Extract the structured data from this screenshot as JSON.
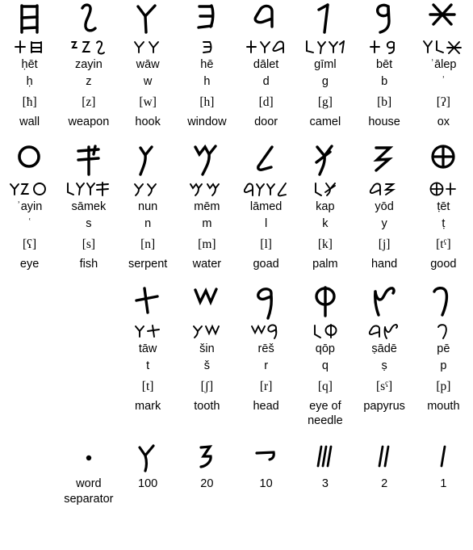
{
  "page": {
    "title": "Phoenician alphabet chart",
    "ink_color": "#000000",
    "background_color": "#ffffff"
  },
  "rows": [
    {
      "row_id": "row-1",
      "letters": [
        {
          "name": "ḥēt",
          "translit": "ḥ",
          "ipa": "[ħ]",
          "meaning": "wall",
          "glyph": "het"
        },
        {
          "name": "zayin",
          "translit": "z",
          "ipa": "[z]",
          "meaning": "weapon",
          "glyph": "zayin"
        },
        {
          "name": "wāw",
          "translit": "w",
          "ipa": "[w]",
          "meaning": "hook",
          "glyph": "waw"
        },
        {
          "name": "hē",
          "translit": "h",
          "ipa": "[h]",
          "meaning": "window",
          "glyph": "he"
        },
        {
          "name": "dālet",
          "translit": "d",
          "ipa": "[d]",
          "meaning": "door",
          "glyph": "dalet"
        },
        {
          "name": "gīml",
          "translit": "g",
          "ipa": "[g]",
          "meaning": "camel",
          "glyph": "giml"
        },
        {
          "name": "bēt",
          "translit": "b",
          "ipa": "[b]",
          "meaning": "house",
          "glyph": "bet"
        },
        {
          "name": "ʾālep",
          "translit": "ʾ",
          "ipa": "[ʔ]",
          "meaning": "ox",
          "glyph": "alep"
        }
      ]
    },
    {
      "row_id": "row-2",
      "letters": [
        {
          "name": "ʾayin",
          "translit": "ʿ",
          "ipa": "[ʕ]",
          "meaning": "eye",
          "glyph": "ayin"
        },
        {
          "name": "sāmek",
          "translit": "s",
          "ipa": "[s]",
          "meaning": "fish",
          "glyph": "samek"
        },
        {
          "name": "nun",
          "translit": "n",
          "ipa": "[n]",
          "meaning": "serpent",
          "glyph": "nun"
        },
        {
          "name": "mēm",
          "translit": "m",
          "ipa": "[m]",
          "meaning": "water",
          "glyph": "mem"
        },
        {
          "name": "lāmed",
          "translit": "l",
          "ipa": "[l]",
          "meaning": "goad",
          "glyph": "lamed"
        },
        {
          "name": "kap",
          "translit": "k",
          "ipa": "[k]",
          "meaning": "palm",
          "glyph": "kap"
        },
        {
          "name": "yōd",
          "translit": "y",
          "ipa": "[j]",
          "meaning": "hand",
          "glyph": "yod"
        },
        {
          "name": "ṭēt",
          "translit": "ṭ",
          "ipa": "[tˤ]",
          "meaning": "good",
          "glyph": "tet"
        }
      ]
    },
    {
      "row_id": "row-3",
      "letters": [
        {
          "name": "",
          "translit": "",
          "ipa": "",
          "meaning": "",
          "glyph": ""
        },
        {
          "name": "",
          "translit": "",
          "ipa": "",
          "meaning": "",
          "glyph": ""
        },
        {
          "name": "tāw",
          "translit": "t",
          "ipa": "[t]",
          "meaning": "mark",
          "glyph": "taw"
        },
        {
          "name": "šin",
          "translit": "š",
          "ipa": "[ʃ]",
          "meaning": "tooth",
          "glyph": "shin"
        },
        {
          "name": "rēš",
          "translit": "r",
          "ipa": "[r]",
          "meaning": "head",
          "glyph": "resh"
        },
        {
          "name": "qōp",
          "translit": "q",
          "ipa": "[q]",
          "meaning": "eye of needle",
          "glyph": "qop"
        },
        {
          "name": "ṣādē",
          "translit": "ṣ",
          "ipa": "[sˤ]",
          "meaning": "papyrus",
          "glyph": "sade"
        },
        {
          "name": "pē",
          "translit": "p",
          "ipa": "[p]",
          "meaning": "mouth",
          "glyph": "pe"
        }
      ]
    }
  ],
  "numerals": {
    "row_id": "numerals-row",
    "items": [
      {
        "label": "",
        "glyph": ""
      },
      {
        "label": "word separator",
        "glyph": "word-separator"
      },
      {
        "label": "100",
        "glyph": "num-100"
      },
      {
        "label": "20",
        "glyph": "num-20"
      },
      {
        "label": "10",
        "glyph": "num-10"
      },
      {
        "label": "3",
        "glyph": "num-3"
      },
      {
        "label": "2",
        "glyph": "num-2"
      },
      {
        "label": "1",
        "glyph": "num-1"
      }
    ]
  }
}
